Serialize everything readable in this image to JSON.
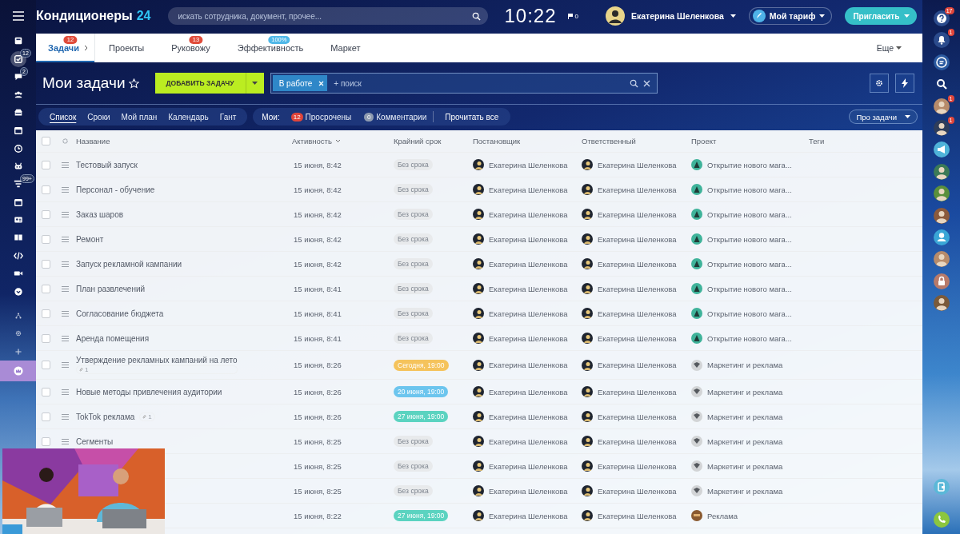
{
  "top_bar": {
    "brand": "Кондиционеры",
    "brand_suffix": "24",
    "search_placeholder": "искать сотрудника, документ, прочее...",
    "clock": "10:22",
    "flag_count": "0",
    "user": "Екатерина Шеленкова",
    "plan_button": "Мой тариф",
    "invite_button": "Пригласить"
  },
  "left_sidebar": [
    {
      "selected": false
    },
    {
      "badge": "12",
      "selected": true
    },
    {
      "badge": "2",
      "selected": false
    },
    {
      "selected": false
    },
    {
      "selected": false
    },
    {
      "selected": false
    },
    {
      "selected": false
    },
    {
      "selected": false
    },
    {
      "badge": "99+",
      "selected": false
    },
    {
      "selected": false
    },
    {
      "selected": false
    },
    {
      "selected": false
    },
    {
      "selected": false
    },
    {
      "selected": false
    },
    {
      "selected": false
    },
    {
      "selected": false
    },
    {
      "selected": false
    },
    {
      "selected": false
    },
    {
      "selected": false
    }
  ],
  "tabs": [
    {
      "label": "Задачи",
      "badge": "12",
      "selected": true
    },
    {
      "label": "Проекты",
      "selected": false
    },
    {
      "label": "Руковожу",
      "badge": "13",
      "selected": false
    },
    {
      "label": "Эффективность",
      "badge": "100%",
      "selected": false
    },
    {
      "label": "Маркет",
      "selected": false
    }
  ],
  "tabs_more": "Еще",
  "page_title": "Мои задачи",
  "add_button": "ДОБАВИТЬ ЗАДАЧУ",
  "filter": {
    "chip": "В работе",
    "placeholder": "+ поиск"
  },
  "views": [
    {
      "label": "Список",
      "selected": true
    },
    {
      "label": "Сроки",
      "selected": false
    },
    {
      "label": "Мой план",
      "selected": false
    },
    {
      "label": "Календарь",
      "selected": false
    },
    {
      "label": "Гант",
      "selected": false
    }
  ],
  "counters": {
    "label": "Мои:",
    "items": [
      {
        "count": "12",
        "label": "Просрочены",
        "kind": "overdue"
      },
      {
        "count": "0",
        "label": "Комментарии",
        "kind": "comments"
      }
    ],
    "read_all": "Прочитать все"
  },
  "help_button": "Про задачи",
  "table": {
    "all_checked": false,
    "columns": [
      {
        "label": "Название",
        "sorted": false
      },
      {
        "label": "Активность",
        "sorted": true
      },
      {
        "label": "Крайний срок",
        "sorted": false
      },
      {
        "label": "Постановщик",
        "sorted": false
      },
      {
        "label": "Ответственный",
        "sorted": false
      },
      {
        "label": "Проект",
        "sorted": false
      },
      {
        "label": "Теги",
        "sorted": false
      }
    ],
    "rows": [
      {
        "checked": false,
        "title": "Тестовый запуск",
        "activity": "15 июня, 8:42",
        "deadline": {
          "text": "Без срока",
          "kind": "none"
        },
        "creator": "Екатерина Шеленкова",
        "responsible": "Екатерина Шеленкова",
        "project": {
          "name": "Открытие нового мага...",
          "kind": "shop"
        }
      },
      {
        "checked": false,
        "title": "Персонал - обучение",
        "activity": "15 июня, 8:42",
        "deadline": {
          "text": "Без срока",
          "kind": "none"
        },
        "creator": "Екатерина Шеленкова",
        "responsible": "Екатерина Шеленкова",
        "project": {
          "name": "Открытие нового мага...",
          "kind": "shop"
        }
      },
      {
        "checked": false,
        "title": "Заказ шаров",
        "activity": "15 июня, 8:42",
        "deadline": {
          "text": "Без срока",
          "kind": "none"
        },
        "creator": "Екатерина Шеленкова",
        "responsible": "Екатерина Шеленкова",
        "project": {
          "name": "Открытие нового мага...",
          "kind": "shop"
        }
      },
      {
        "checked": false,
        "title": "Ремонт",
        "activity": "15 июня, 8:42",
        "deadline": {
          "text": "Без срока",
          "kind": "none"
        },
        "creator": "Екатерина Шеленкова",
        "responsible": "Екатерина Шеленкова",
        "project": {
          "name": "Открытие нового мага...",
          "kind": "shop"
        }
      },
      {
        "checked": false,
        "title": "Запуск рекламной кампании",
        "activity": "15 июня, 8:42",
        "deadline": {
          "text": "Без срока",
          "kind": "none"
        },
        "creator": "Екатерина Шеленкова",
        "responsible": "Екатерина Шеленкова",
        "project": {
          "name": "Открытие нового мага...",
          "kind": "shop"
        }
      },
      {
        "checked": false,
        "title": "План развлечений",
        "activity": "15 июня, 8:41",
        "deadline": {
          "text": "Без срока",
          "kind": "none"
        },
        "creator": "Екатерина Шеленкова",
        "responsible": "Екатерина Шеленкова",
        "project": {
          "name": "Открытие нового мага...",
          "kind": "shop"
        }
      },
      {
        "checked": false,
        "title": "Согласование бюджета",
        "activity": "15 июня, 8:41",
        "deadline": {
          "text": "Без срока",
          "kind": "none"
        },
        "creator": "Екатерина Шеленкова",
        "responsible": "Екатерина Шеленкова",
        "project": {
          "name": "Открытие нового мага...",
          "kind": "shop"
        }
      },
      {
        "checked": false,
        "title": "Аренда помещения",
        "activity": "15 июня, 8:41",
        "deadline": {
          "text": "Без срока",
          "kind": "none"
        },
        "creator": "Екатерина Шеленкова",
        "responsible": "Екатерина Шеленкова",
        "project": {
          "name": "Открытие нового мага...",
          "kind": "shop"
        }
      },
      {
        "checked": false,
        "title": "Утверждение рекламных кампаний на лето",
        "attachments": "1",
        "activity": "15 июня, 8:26",
        "deadline": {
          "text": "Сегодня, 19:00",
          "kind": "today"
        },
        "creator": "Екатерина Шеленкова",
        "responsible": "Екатерина Шеленкова",
        "project": {
          "name": "Маркетинг и реклама",
          "kind": "marketing"
        }
      },
      {
        "checked": false,
        "title": "Новые методы привлечения аудитории",
        "activity": "15 июня, 8:26",
        "deadline": {
          "text": "20 июня, 19:00",
          "kind": "week"
        },
        "creator": "Екатерина Шеленкова",
        "responsible": "Екатерина Шеленкова",
        "project": {
          "name": "Маркетинг и реклама",
          "kind": "marketing"
        }
      },
      {
        "checked": false,
        "title": "TokTok реклама",
        "attachments": "1",
        "activity": "15 июня, 8:26",
        "deadline": {
          "text": "27 июня, 19:00",
          "kind": "later"
        },
        "creator": "Екатерина Шеленкова",
        "responsible": "Екатерина Шеленкова",
        "project": {
          "name": "Маркетинг и реклама",
          "kind": "marketing"
        }
      },
      {
        "checked": false,
        "title": "Сегменты",
        "activity": "15 июня, 8:25",
        "deadline": {
          "text": "Без срока",
          "kind": "none"
        },
        "creator": "Екатерина Шеленкова",
        "responsible": "Екатерина Шеленкова",
        "project": {
          "name": "Маркетинг и реклама",
          "kind": "marketing"
        }
      },
      {
        "activity": "15 июня, 8:25",
        "deadline": {
          "text": "Без срока",
          "kind": "none"
        },
        "creator": "Екатерина Шеленкова",
        "responsible": "Екатерина Шеленкова",
        "project": {
          "name": "Маркетинг и реклама",
          "kind": "marketing"
        }
      },
      {
        "activity": "15 июня, 8:25",
        "deadline": {
          "text": "Без срока",
          "kind": "none"
        },
        "creator": "Екатерина Шеленкова",
        "responsible": "Екатерина Шеленкова",
        "project": {
          "name": "Маркетинг и реклама",
          "kind": "marketing"
        }
      },
      {
        "activity": "15 июня, 8:22",
        "deadline": {
          "text": "27 июня, 19:00",
          "kind": "later"
        },
        "creator": "Екатерина Шеленкова",
        "responsible": "Екатерина Шеленкова",
        "project": {
          "name": "Реклама",
          "kind": "ads"
        }
      }
    ]
  },
  "right_sidebar": [
    {
      "kind": "button",
      "badge": "17"
    },
    {
      "kind": "button",
      "badge": "1"
    },
    {
      "kind": "button"
    },
    {
      "kind": "button"
    },
    {
      "kind": "avatar",
      "badge": "1"
    },
    {
      "kind": "avatar",
      "badge": "1"
    },
    {
      "kind": "button"
    },
    {
      "kind": "avatar"
    },
    {
      "kind": "avatar"
    },
    {
      "kind": "avatar"
    },
    {
      "kind": "button"
    },
    {
      "kind": "avatar"
    },
    {
      "kind": "button"
    },
    {
      "kind": "avatar"
    }
  ]
}
